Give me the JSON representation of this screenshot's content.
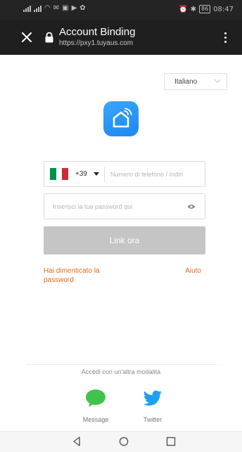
{
  "status_bar": {
    "time": "08:47",
    "battery": "86"
  },
  "header": {
    "title": "Account Binding",
    "url": "https://pxy1.tuyaus.com"
  },
  "language": {
    "selected": "Italiano"
  },
  "phone": {
    "country_code": "+39",
    "placeholder": "Numero di telefono / Indiri"
  },
  "password": {
    "placeholder": "Inserisci la tua password qui"
  },
  "link_button": {
    "label": "Link ora"
  },
  "links": {
    "forgot": "Hai dimenticato la password",
    "help": "Aiuto"
  },
  "alt_login": {
    "label": "Accedi con un'altra modalità",
    "options": [
      {
        "label": "Message",
        "icon": "message-bubble-icon",
        "color": "#3fc34b"
      },
      {
        "label": "Twitter",
        "icon": "twitter-bird-icon",
        "color": "#1da1f2"
      }
    ]
  },
  "colors": {
    "accent_link": "#e06c1f",
    "button_disabled": "#c5c5c5",
    "app_logo": "#2196f3",
    "header_bg": "#1f1f1f"
  },
  "flag_colors": [
    "#009246",
    "#ffffff",
    "#ce2b37"
  ]
}
